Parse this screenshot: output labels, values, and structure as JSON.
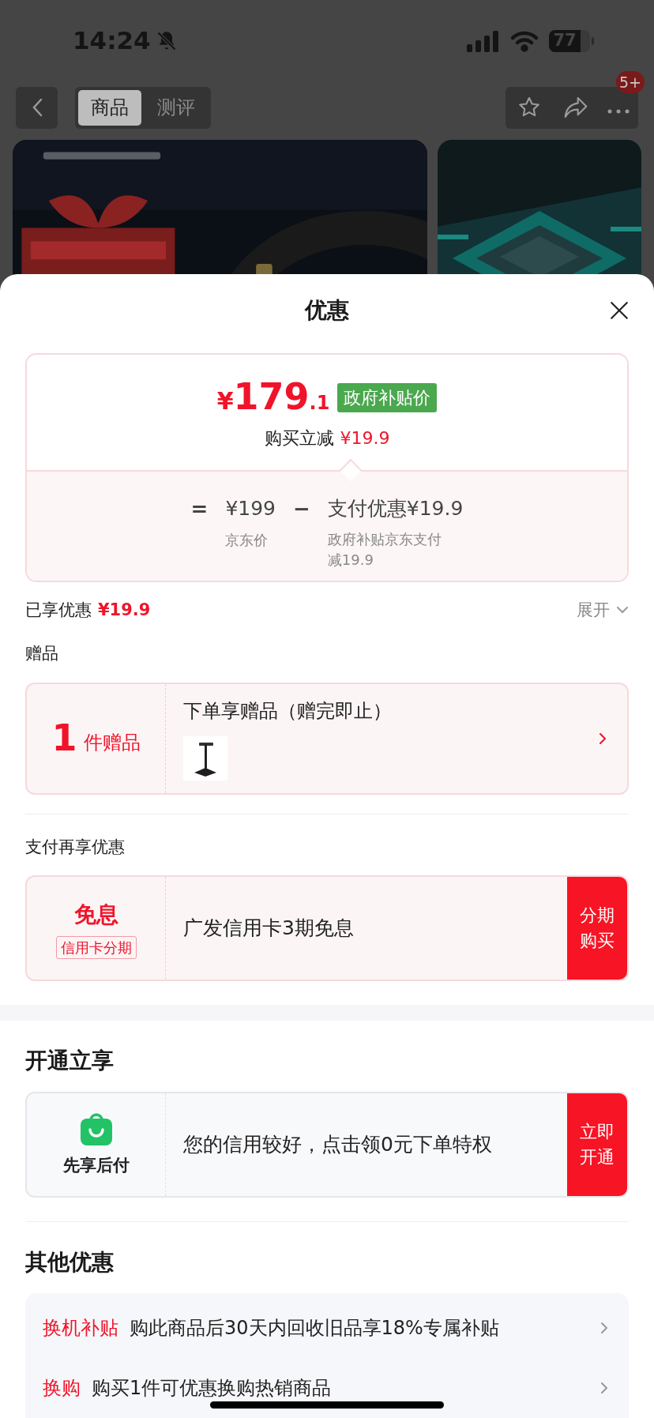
{
  "status_bar": {
    "time": "14:24",
    "battery": "77"
  },
  "nav": {
    "tabs": [
      {
        "label": "商品",
        "selected": true
      },
      {
        "label": "测评",
        "selected": false
      }
    ],
    "badge": "5+"
  },
  "sheet": {
    "title": "优惠",
    "price_card": {
      "currency": "¥",
      "integer": "179",
      "decimal": ".1",
      "tag": "政府补贴价",
      "instant_label": "购买立减",
      "instant_amount": "¥19.9",
      "equals": "=",
      "base_price": "¥199",
      "base_label": "京东价",
      "minus": "−",
      "payment": "支付优惠¥19.9",
      "payment_note": "政府补贴京东支付减19.9"
    },
    "savings": {
      "label": "已享优惠",
      "amount": "¥19.9",
      "expand": "展开"
    },
    "gifts": {
      "title": "赠品",
      "count": "1",
      "count_unit": "件赠品",
      "headline": "下单享赠品（赠完即止）"
    },
    "payment": {
      "title": "支付再享优惠",
      "badge": "免息",
      "tag": "信用卡分期",
      "text": "广发信用卡3期免息",
      "button": "分期购买"
    },
    "activate": {
      "title": "开通立享",
      "name": "先享后付",
      "text": "您的信用较好，点击领0元下单特权",
      "button": "立即开通"
    },
    "others": {
      "title": "其他优惠",
      "items": [
        {
          "tag": "换机补贴",
          "text": "购此商品后30天内回收旧品享18%专属补贴"
        },
        {
          "tag": "换购",
          "text": "购买1件可优惠换购热销商品"
        }
      ]
    }
  }
}
